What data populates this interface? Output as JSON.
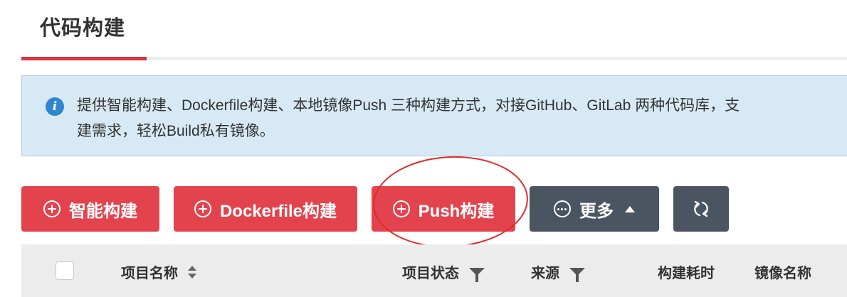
{
  "header": {
    "title": "代码构建"
  },
  "info": {
    "line1": "提供智能构建、Dockerfile构建、本地镜像Push 三种构建方式，对接GitHub、GitLab 两种代码库，支",
    "line2": "建需求，轻松Build私有镜像。"
  },
  "toolbar": {
    "smart_build": "智能构建",
    "dockerfile_build": "Dockerfile构建",
    "push_build": "Push构建",
    "more": "更多"
  },
  "table": {
    "columns": [
      "项目名称",
      "项目状态",
      "来源",
      "构建耗时",
      "镜像名称"
    ]
  },
  "colors": {
    "accent_red": "#e3434d",
    "dark_button": "#4b5561",
    "info_bg": "#d7e9f5",
    "info_icon": "#2f86cf",
    "annotation": "#e22a2a"
  }
}
